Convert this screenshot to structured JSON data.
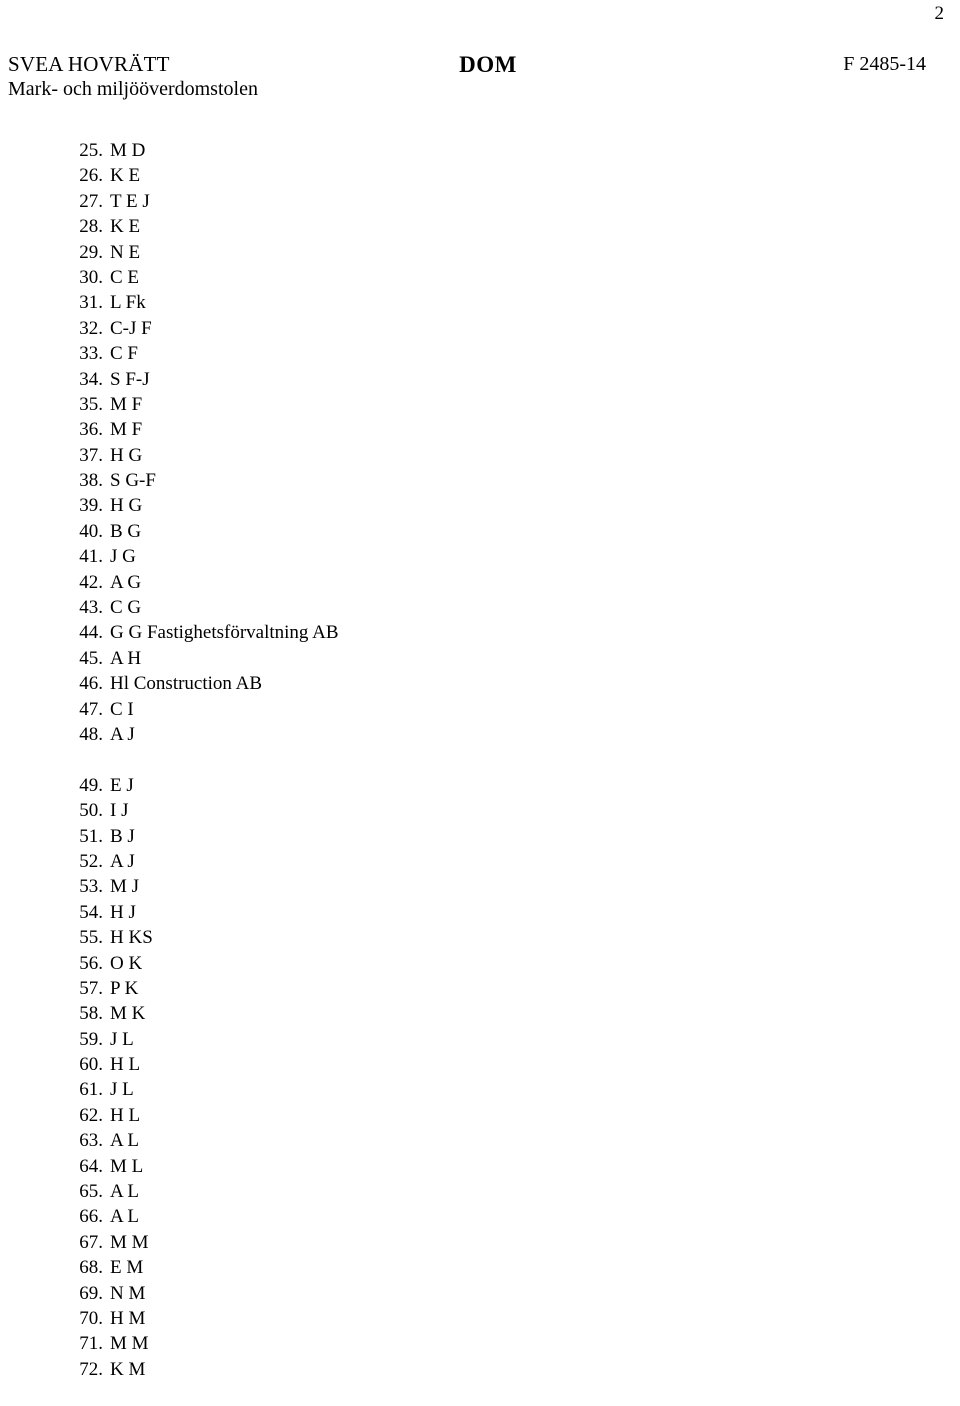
{
  "page": {
    "number": "2"
  },
  "header": {
    "court": "SVEA HOVRÄTT",
    "division": "Mark- och miljööverdomstolen",
    "doc_type": "DOM",
    "case_number": "F 2485-14"
  },
  "party_list": {
    "items": [
      {
        "num": "25.",
        "name": "M D",
        "gap_before": false
      },
      {
        "num": "26.",
        "name": "K E",
        "gap_before": false
      },
      {
        "num": "27.",
        "name": "T E J",
        "gap_before": false
      },
      {
        "num": "28.",
        "name": "K E",
        "gap_before": false
      },
      {
        "num": "29.",
        "name": "N E",
        "gap_before": false
      },
      {
        "num": "30.",
        "name": "C E",
        "gap_before": false
      },
      {
        "num": "31.",
        "name": "L Fk",
        "gap_before": false
      },
      {
        "num": "32.",
        "name": "C-J F",
        "gap_before": false
      },
      {
        "num": "33.",
        "name": "C F",
        "gap_before": false
      },
      {
        "num": "34.",
        "name": "S F-J",
        "gap_before": false
      },
      {
        "num": "35.",
        "name": "M F",
        "gap_before": false
      },
      {
        "num": "36.",
        "name": "M F",
        "gap_before": false
      },
      {
        "num": "37.",
        "name": "H G",
        "gap_before": false
      },
      {
        "num": "38.",
        "name": "S G-F",
        "gap_before": false
      },
      {
        "num": "39.",
        "name": "H G",
        "gap_before": false
      },
      {
        "num": "40.",
        "name": "B G",
        "gap_before": false
      },
      {
        "num": "41.",
        "name": "J G",
        "gap_before": false
      },
      {
        "num": "42.",
        "name": "A G",
        "gap_before": false
      },
      {
        "num": "43.",
        "name": "C G",
        "gap_before": false
      },
      {
        "num": "44.",
        "name": "G G Fastighetsförvaltning AB",
        "gap_before": false
      },
      {
        "num": "45.",
        "name": "A H",
        "gap_before": false
      },
      {
        "num": "46.",
        "name": "Hl Construction AB",
        "gap_before": false
      },
      {
        "num": "47.",
        "name": "C I",
        "gap_before": false
      },
      {
        "num": "48.",
        "name": "A J",
        "gap_before": false
      },
      {
        "num": "49.",
        "name": "E J",
        "gap_before": true
      },
      {
        "num": "50.",
        "name": "I J",
        "gap_before": false
      },
      {
        "num": "51.",
        "name": "B J",
        "gap_before": false
      },
      {
        "num": "52.",
        "name": "A J",
        "gap_before": false
      },
      {
        "num": "53.",
        "name": "M J",
        "gap_before": false
      },
      {
        "num": "54.",
        "name": "H J",
        "gap_before": false
      },
      {
        "num": "55.",
        "name": "H KS",
        "gap_before": false
      },
      {
        "num": "56.",
        "name": "O K",
        "gap_before": false
      },
      {
        "num": "57.",
        "name": "P K",
        "gap_before": false
      },
      {
        "num": "58.",
        "name": "M K",
        "gap_before": false
      },
      {
        "num": "59.",
        "name": "J L",
        "gap_before": false
      },
      {
        "num": "60.",
        "name": "H L",
        "gap_before": false
      },
      {
        "num": "61.",
        "name": "J L",
        "gap_before": false
      },
      {
        "num": "62.",
        "name": "H L",
        "gap_before": false
      },
      {
        "num": "63.",
        "name": "A L",
        "gap_before": false
      },
      {
        "num": "64.",
        "name": "M L",
        "gap_before": false
      },
      {
        "num": "65.",
        "name": "A L",
        "gap_before": false
      },
      {
        "num": "66.",
        "name": "A L",
        "gap_before": false
      },
      {
        "num": "67.",
        "name": "M M",
        "gap_before": false
      },
      {
        "num": "68.",
        "name": "E M",
        "gap_before": false
      },
      {
        "num": "69.",
        "name": "N M",
        "gap_before": false
      },
      {
        "num": "70.",
        "name": "H M",
        "gap_before": false
      },
      {
        "num": "71.",
        "name": "M M",
        "gap_before": false
      },
      {
        "num": "72.",
        "name": "K M",
        "gap_before": false
      }
    ]
  }
}
